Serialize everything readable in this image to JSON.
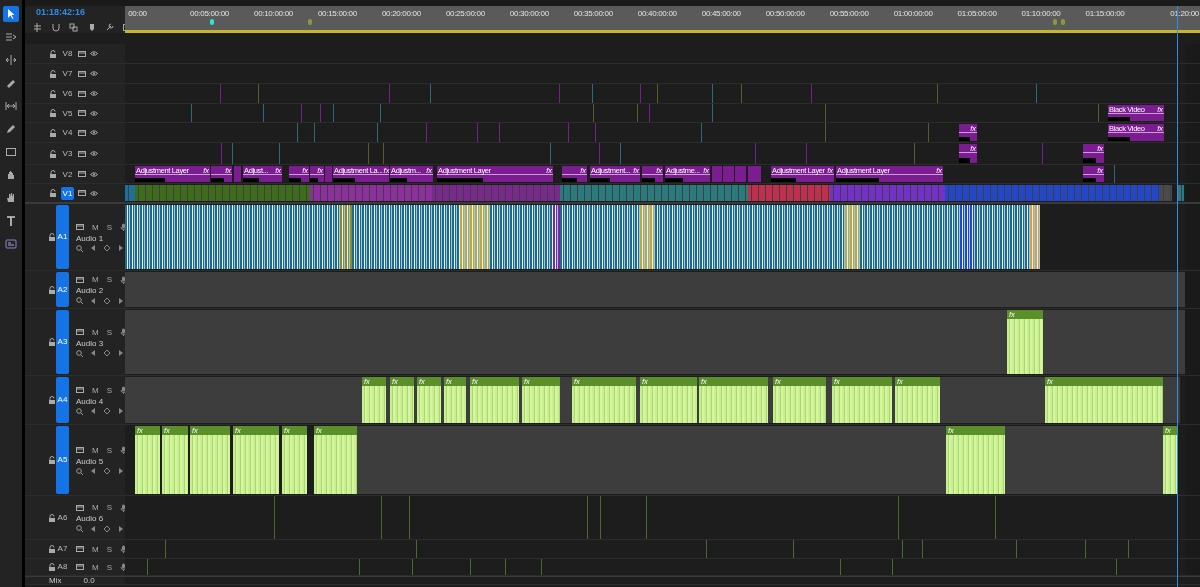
{
  "timecode": "01:18:42:16",
  "tools": [
    {
      "selected": true
    },
    {
      "selected": false
    },
    {
      "selected": false
    },
    {
      "selected": false
    },
    {
      "selected": false
    },
    {
      "selected": false
    },
    {
      "selected": false
    },
    {
      "selected": false
    },
    {
      "selected": false
    },
    {
      "selected": false
    },
    {
      "selected": false
    }
  ],
  "ruler": {
    "labels": [
      "00:00",
      "00:05:00:00",
      "00:10:00:00",
      "00:15:00:00",
      "00:20:00:00",
      "00:25:00:00",
      "00:30:00:00",
      "00:35:00:00",
      "00:40:00:00",
      "00:45:00:00",
      "00:50:00:00",
      "00:55:00:00",
      "01:00:00:00",
      "01:05:00:00",
      "01:10:00:00",
      "01:15:00:00",
      "01:20:00"
    ]
  },
  "video_tracks": [
    {
      "label": "V8",
      "targeted": false
    },
    {
      "label": "V7",
      "targeted": false
    },
    {
      "label": "V6",
      "targeted": false
    },
    {
      "label": "V5",
      "targeted": false,
      "clips": [
        {
          "label": "Black Video",
          "fx": "fx"
        }
      ]
    },
    {
      "label": "V4",
      "targeted": false,
      "clips": [
        {
          "fx": "fx"
        },
        {
          "label": "Black Video",
          "fx": "fx"
        }
      ]
    },
    {
      "label": "V3",
      "targeted": false,
      "clips": [
        {
          "fx": "fx"
        },
        {
          "fx": "fx"
        }
      ]
    },
    {
      "label": "V2",
      "targeted": false,
      "clips": [
        {
          "label": "Adjustment Layer",
          "fx": "fx"
        },
        {
          "fx": "fx"
        },
        {
          "label": "Adjust...",
          "fx": "fx"
        },
        {
          "fx": "fx"
        },
        {
          "fx": "fx"
        },
        {
          "label": "Adjustment La...",
          "fx": "fx"
        },
        {
          "label": "Adjustm...",
          "fx": "fx"
        },
        {
          "label": "Adjustment Layer",
          "fx": "fx"
        },
        {
          "fx": "fx"
        },
        {
          "label": "Adjustment...",
          "fx": "fx"
        },
        {
          "fx": "fx"
        },
        {
          "label": "Adjustme...",
          "fx": "fx"
        },
        {
          "label": "Adjustment Layer",
          "fx": "fx"
        },
        {
          "label": "Adjustment Layer",
          "fx": "fx"
        },
        {
          "fx": "fx"
        }
      ]
    },
    {
      "label": "V1",
      "targeted": true
    }
  ],
  "audio_tracks": [
    {
      "label": "A1",
      "name": "Audio 1",
      "targeted": true,
      "mute": "M",
      "solo": "S"
    },
    {
      "label": "A2",
      "name": "Audio 2",
      "targeted": true,
      "mute": "M",
      "solo": "S"
    },
    {
      "label": "A3",
      "name": "Audio 3",
      "targeted": true,
      "mute": "M",
      "solo": "S",
      "clips": [
        {
          "fx": "fx"
        }
      ]
    },
    {
      "label": "A4",
      "name": "Audio 4",
      "targeted": true,
      "mute": "M",
      "solo": "S",
      "clips": [
        {
          "fx": "fx"
        },
        {
          "fx": "fx"
        },
        {
          "fx": "fx"
        },
        {
          "fx": "fx"
        },
        {
          "fx": "fx"
        },
        {
          "fx": "fx"
        },
        {
          "fx": "fx"
        },
        {
          "fx": "fx"
        },
        {
          "fx": "fx"
        },
        {
          "fx": "fx"
        },
        {
          "fx": "fx"
        },
        {
          "fx": "fx"
        },
        {
          "fx": "fx"
        }
      ]
    },
    {
      "label": "A5",
      "name": "Audio 5",
      "targeted": true,
      "mute": "M",
      "solo": "S",
      "clips": [
        {
          "fx": "fx"
        },
        {
          "fx": "fx"
        },
        {
          "fx": "fx"
        },
        {
          "fx": "fx"
        },
        {
          "fx": "fx"
        },
        {
          "fx": "fx"
        },
        {
          "fx": "fx"
        },
        {
          "fx": "fx"
        }
      ]
    },
    {
      "label": "A6",
      "name": "Audio 6",
      "targeted": false,
      "mute": "M",
      "solo": "S"
    },
    {
      "label": "A7",
      "targeted": false,
      "mute": "M",
      "solo": "S"
    },
    {
      "label": "A8",
      "targeted": false,
      "mute": "M",
      "solo": "S"
    }
  ],
  "mix": {
    "label": "Mix",
    "value": "0.0"
  }
}
